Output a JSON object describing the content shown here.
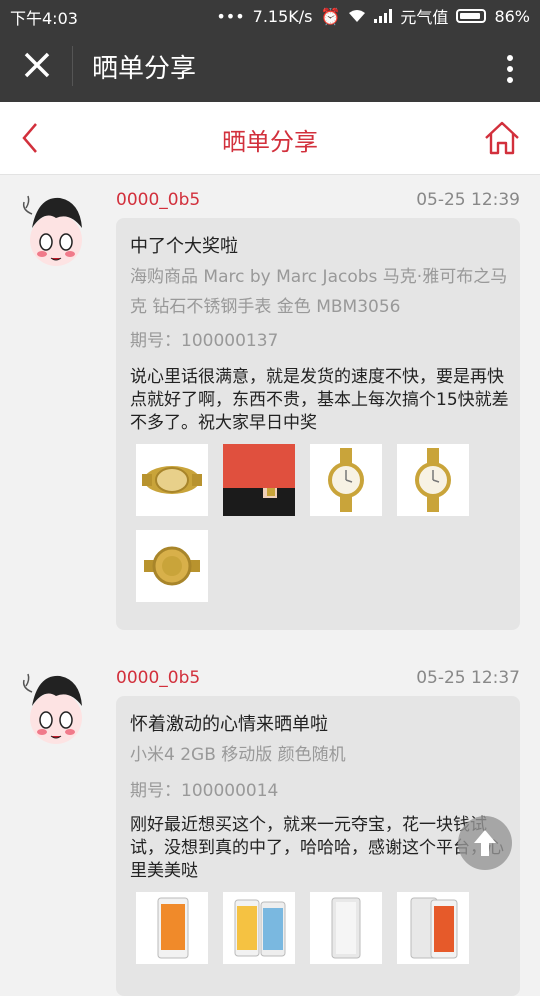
{
  "status": {
    "time": "下午4:03",
    "dots": "•••",
    "speed": "7.15K/s",
    "carrier": "元气值",
    "battery": "86%"
  },
  "appbar": {
    "title": "晒单分享"
  },
  "navbar": {
    "title": "晒单分享"
  },
  "posts": [
    {
      "user": "0000_0b5",
      "time": "05-25 12:39",
      "title": "中了个大奖啦",
      "product": "海购商品 Marc by Marc Jacobs 马克·雅可布之马克 钻石不锈钢手表 金色 MBM3056",
      "period_label": "期号：",
      "period": "100000137",
      "text": "说心里话很满意，就是发货的速度不快，要是再快点就好了啊，东西不贵，基本上每次搞个15快就差不多了。祝大家早日中奖"
    },
    {
      "user": "0000_0b5",
      "time": "05-25 12:37",
      "title": "怀着激动的心情来晒单啦",
      "product": "小米4 2GB 移动版 颜色随机",
      "period_label": "期号：",
      "period": "100000014",
      "text": "刚好最近想买这个，就来一元夺宝，花一块钱试试，没想到真的中了，哈哈哈，感谢这个平台，心里美美哒"
    }
  ],
  "colors": {
    "accent": "#d2303c",
    "topbar": "#3a3a3a",
    "card": "#e5e5e5"
  }
}
